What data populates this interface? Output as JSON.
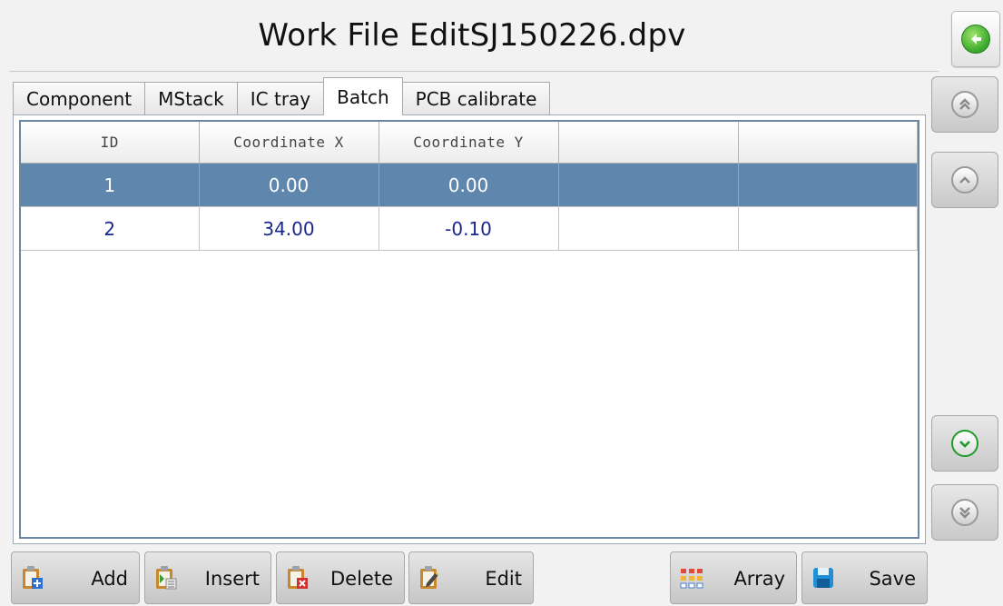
{
  "window": {
    "title": "Work File EditSJ150226.dpv"
  },
  "tabs": [
    {
      "label": "Component",
      "active": false
    },
    {
      "label": "MStack",
      "active": false
    },
    {
      "label": "IC tray",
      "active": false
    },
    {
      "label": "Batch",
      "active": true
    },
    {
      "label": "PCB calibrate",
      "active": false
    }
  ],
  "table": {
    "columns": [
      "ID",
      "Coordinate X",
      "Coordinate Y",
      "",
      ""
    ],
    "rows": [
      {
        "id": "1",
        "x": "0.00",
        "y": "0.00",
        "selected": true
      },
      {
        "id": "2",
        "x": "34.00",
        "y": "-0.10",
        "selected": false
      }
    ]
  },
  "side_buttons": [
    {
      "icon": "double-chevron-up-icon"
    },
    {
      "icon": "chevron-up-icon"
    },
    {
      "icon": "chevron-down-icon"
    },
    {
      "icon": "double-chevron-down-icon"
    }
  ],
  "toolbar": {
    "add_label": "Add",
    "insert_label": "Insert",
    "delete_label": "Delete",
    "edit_label": "Edit",
    "array_label": "Array",
    "save_label": "Save"
  },
  "colors": {
    "selected_row": "#5f87ad",
    "value_text": "#1a2790",
    "accent_green": "#1f9b2a"
  }
}
